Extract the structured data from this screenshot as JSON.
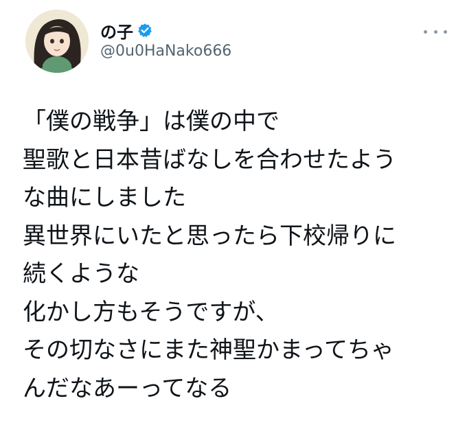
{
  "user": {
    "display_name": "の子",
    "handle": "@0u0HaNako666",
    "verified": true
  },
  "tweet": {
    "lines": [
      "「僕の戦争」は僕の中で",
      "聖歌と日本昔ばなしを合わせたよう",
      "な曲にしました",
      "異世界にいたと思ったら下校帰りに",
      "続くような",
      "化かし方もそうですが、",
      "その切なさにまた神聖かまってちゃ",
      "んだなあーってなる"
    ]
  },
  "colors": {
    "verified_badge": "#1d9bf0",
    "handle": "#536471",
    "text": "#0f1419",
    "more_dots": "#8b98a5"
  },
  "icons": {
    "verified": "verified-badge-icon",
    "more": "more-options-icon"
  }
}
